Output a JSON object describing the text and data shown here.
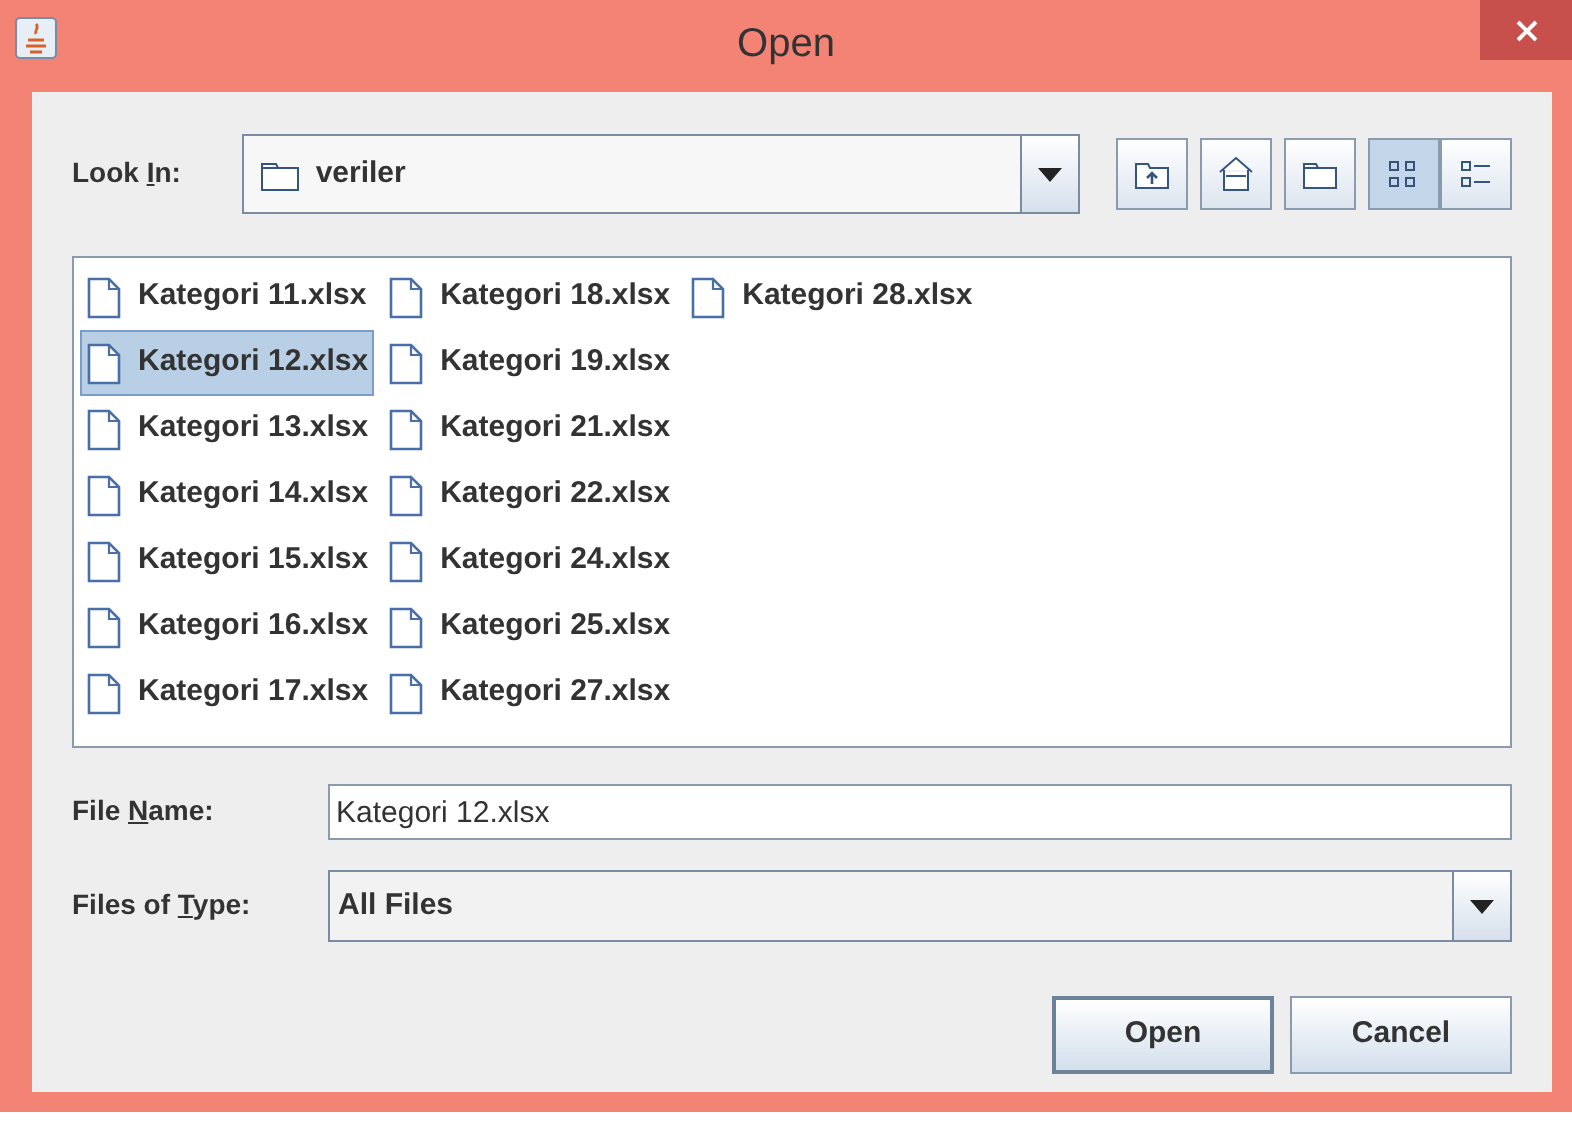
{
  "window": {
    "title": "Open"
  },
  "look_in": {
    "label": [
      {
        "text": "Look ",
        "underlined": false
      },
      {
        "text": "I",
        "underlined": true
      },
      {
        "text": "n:",
        "underlined": false
      }
    ],
    "value": "veriler"
  },
  "toolbar": [
    {
      "kind": "up",
      "selected": false
    },
    {
      "kind": "home",
      "selected": false
    },
    {
      "kind": "new-folder",
      "selected": false
    },
    {
      "kind": "list",
      "selected": true
    },
    {
      "kind": "details",
      "selected": false
    }
  ],
  "files": [
    {
      "name": "Kategori 11.xlsx",
      "selected": false
    },
    {
      "name": "Kategori 12.xlsx",
      "selected": true
    },
    {
      "name": "Kategori 13.xlsx",
      "selected": false
    },
    {
      "name": "Kategori 14.xlsx",
      "selected": false
    },
    {
      "name": "Kategori 15.xlsx",
      "selected": false
    },
    {
      "name": "Kategori 16.xlsx",
      "selected": false
    },
    {
      "name": "Kategori 17.xlsx",
      "selected": false
    },
    {
      "name": "Kategori 18.xlsx",
      "selected": false
    },
    {
      "name": "Kategori 19.xlsx",
      "selected": false
    },
    {
      "name": "Kategori 21.xlsx",
      "selected": false
    },
    {
      "name": "Kategori 22.xlsx",
      "selected": false
    },
    {
      "name": "Kategori 24.xlsx",
      "selected": false
    },
    {
      "name": "Kategori 25.xlsx",
      "selected": false
    },
    {
      "name": "Kategori 27.xlsx",
      "selected": false
    },
    {
      "name": "Kategori 28.xlsx",
      "selected": false
    }
  ],
  "file_name": {
    "label": [
      {
        "text": "File ",
        "underlined": false
      },
      {
        "text": "N",
        "underlined": true
      },
      {
        "text": "ame:",
        "underlined": false
      }
    ],
    "value": "Kategori 12.xlsx"
  },
  "file_type": {
    "label": [
      {
        "text": "Files of ",
        "underlined": false
      },
      {
        "text": "T",
        "underlined": true
      },
      {
        "text": "ype:",
        "underlined": false
      }
    ],
    "value": "All Files"
  },
  "buttons": [
    {
      "label": "Open",
      "kind": "default"
    },
    {
      "label": "Cancel",
      "kind": "normal"
    }
  ]
}
